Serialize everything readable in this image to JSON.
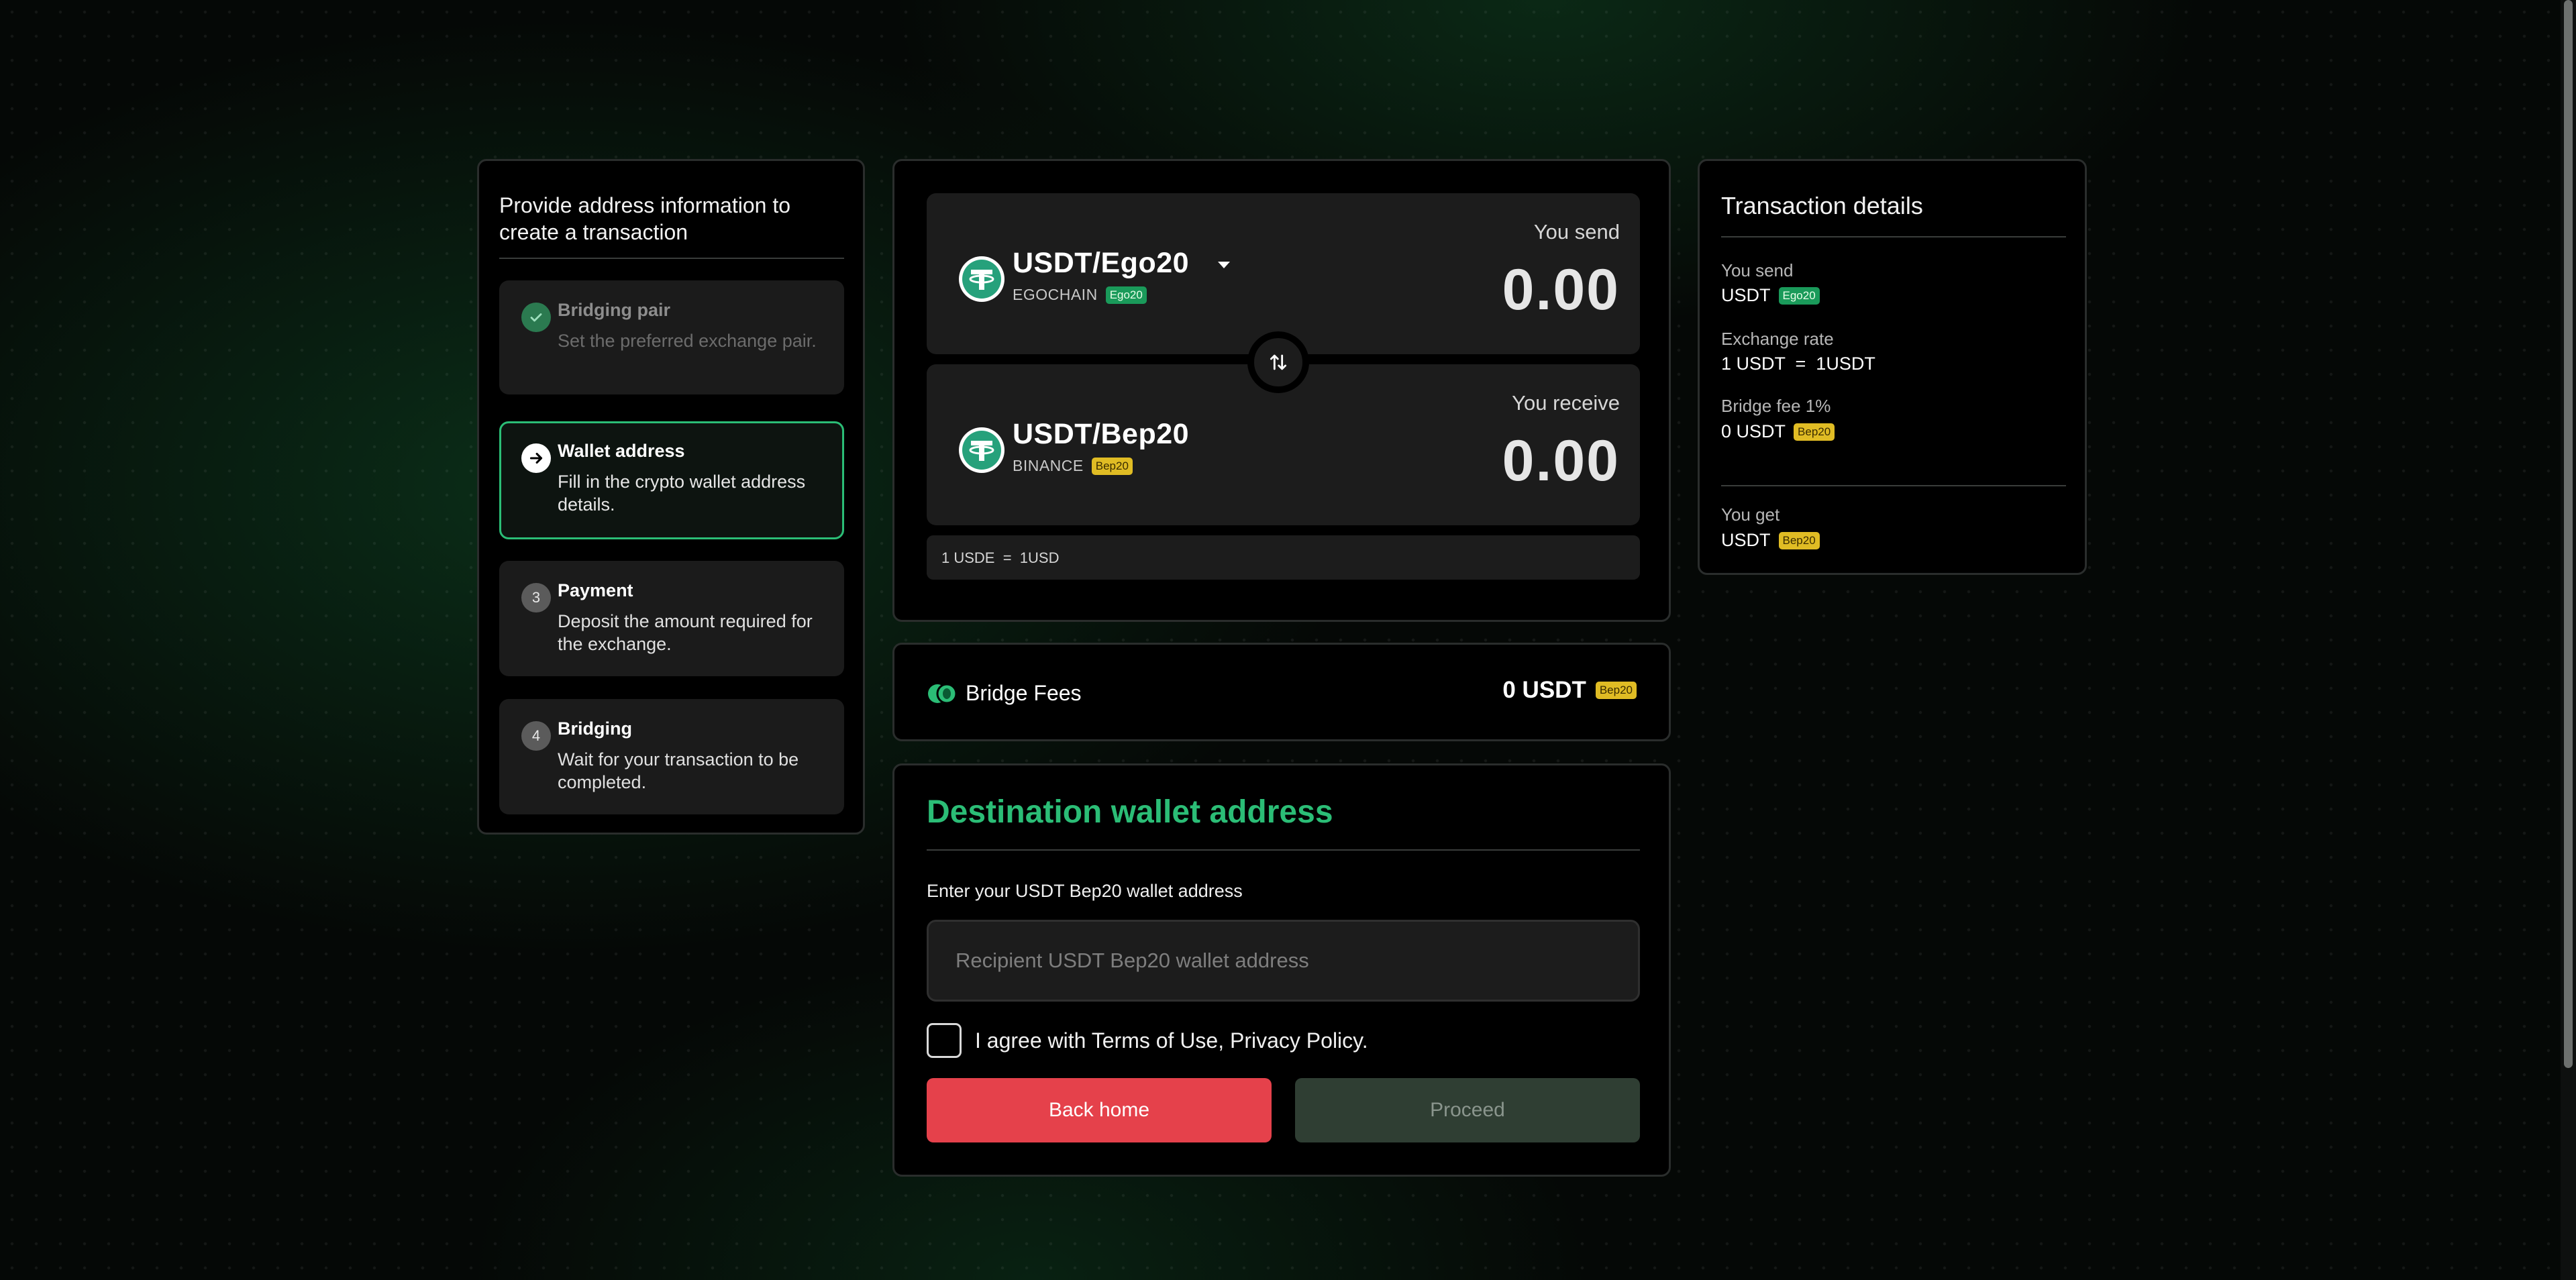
{
  "steps": {
    "title": "Provide address information to create a transaction",
    "items": [
      {
        "badge": "",
        "name": "Bridging pair",
        "desc": "Set the preferred exchange pair."
      },
      {
        "badge": "",
        "name": "Wallet address",
        "desc": "Fill in the crypto wallet address details."
      },
      {
        "badge": "3",
        "name": "Payment",
        "desc": "Deposit the amount required for the exchange."
      },
      {
        "badge": "4",
        "name": "Bridging",
        "desc": "Wait for your transaction to be completed."
      }
    ]
  },
  "exchange": {
    "send": {
      "pair": "USDT/Ego20",
      "chain": "EGOCHAIN",
      "tag": "Ego20",
      "label": "You send",
      "amount": "0.00"
    },
    "receive": {
      "pair": "USDT/Bep20",
      "chain": "BINANCE",
      "tag": "Bep20",
      "label": "You receive",
      "amount": "0.00"
    },
    "rate": "1 USDE  =  1USD"
  },
  "fees": {
    "label": "Bridge Fees",
    "value": "0 USDT",
    "tag": "Bep20"
  },
  "destination": {
    "title": "Destination wallet address",
    "label": "Enter your USDT Bep20 wallet address",
    "placeholder": "Recipient USDT Bep20 wallet address",
    "agree": "I agree with Terms of Use, Privacy Policy.",
    "back": "Back home",
    "proceed": "Proceed"
  },
  "details": {
    "title": "Transaction details",
    "send_label": "You send",
    "send_value": "USDT",
    "send_tag": "Ego20",
    "rate_label": "Exchange rate",
    "rate_value": "1 USDT  =  1USDT",
    "fee_label": "Bridge fee 1%",
    "fee_value": "0 USDT",
    "fee_tag": "Bep20",
    "get_label": "You get",
    "get_value": "USDT",
    "get_tag": "Bep20"
  },
  "colors": {
    "accent": "#2bbd76",
    "danger": "#e5414b",
    "tag_green": "#1a9a5a",
    "tag_yellow": "#e0bc24",
    "tether": "#26a17b"
  },
  "icons": {
    "step_done": "check-icon",
    "step_active": "arrow-right-icon",
    "swap": "swap-icon",
    "token": "tether-icon",
    "dropdown": "caret-down-icon",
    "fees": "coins-icon"
  }
}
